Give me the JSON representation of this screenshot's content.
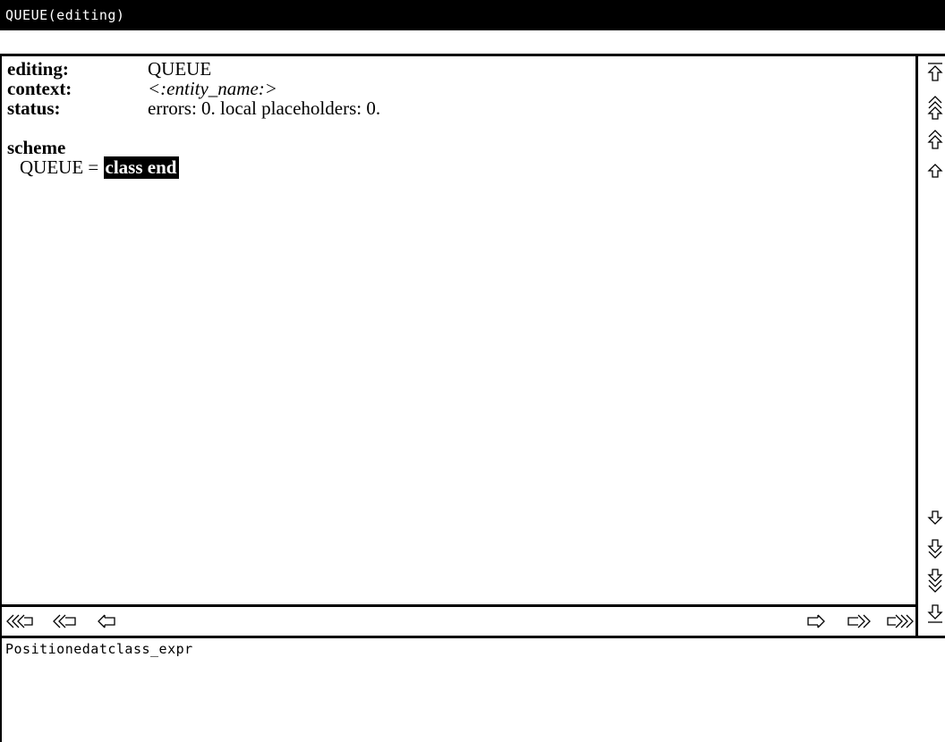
{
  "window": {
    "title": "QUEUE(editing)"
  },
  "header": {
    "editing_label": "editing:",
    "editing_value": "QUEUE",
    "context_label": "context:",
    "context_value": "<:entity_name:>",
    "status_label": "status:",
    "status_value": "errors: 0.  local placeholders: 0."
  },
  "body": {
    "scheme_keyword": "scheme",
    "definition_prefix": "QUEUE =",
    "selected_expr": "class end"
  },
  "status_line": "Positionedatclass_expr",
  "icons": {
    "vertical": [
      "scroll-to-top-icon",
      "page-up-double-icon",
      "page-up-icon",
      "line-up-icon",
      "line-down-icon",
      "page-down-icon",
      "page-down-double-icon",
      "scroll-to-bottom-icon"
    ],
    "horizontal": [
      "scroll-far-left-icon",
      "scroll-page-left-icon",
      "scroll-left-icon",
      "scroll-right-icon",
      "scroll-page-right-icon",
      "scroll-far-right-icon"
    ]
  }
}
